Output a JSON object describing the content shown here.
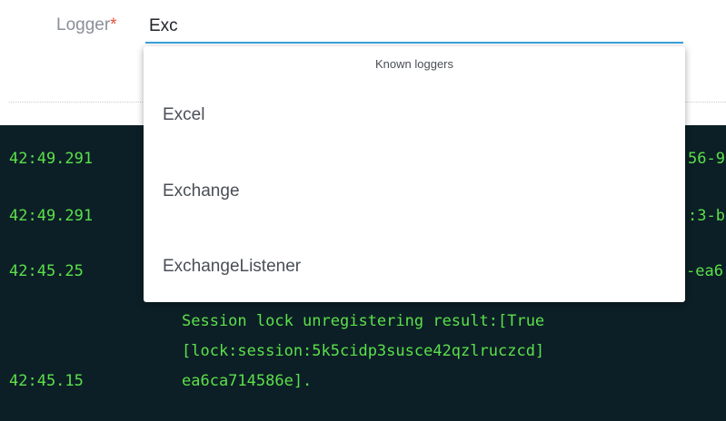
{
  "logger_field": {
    "label": "Logger",
    "required_mark": "*",
    "value": "Exc"
  },
  "dropdown": {
    "header": "Known loggers",
    "options": [
      "Excel",
      "Exchange",
      "ExchangeListener"
    ]
  },
  "console": {
    "timestamps": [
      "42:49.291",
      "42:49.291",
      "42:45.25",
      "42:45.15"
    ],
    "right_fragments": [
      "56-9",
      ":3-b",
      "-ea6",
      ""
    ],
    "message_lines": [
      "Session lock unregistering result:[True",
      "[lock:session:5k5cidp3susce42qzlruczcd]",
      "ea6ca714586e]."
    ]
  },
  "colors": {
    "console_bg": "#0c1f26",
    "console_text": "#5be04a",
    "input_underline": "#3aa0db",
    "required": "#e5533f"
  }
}
